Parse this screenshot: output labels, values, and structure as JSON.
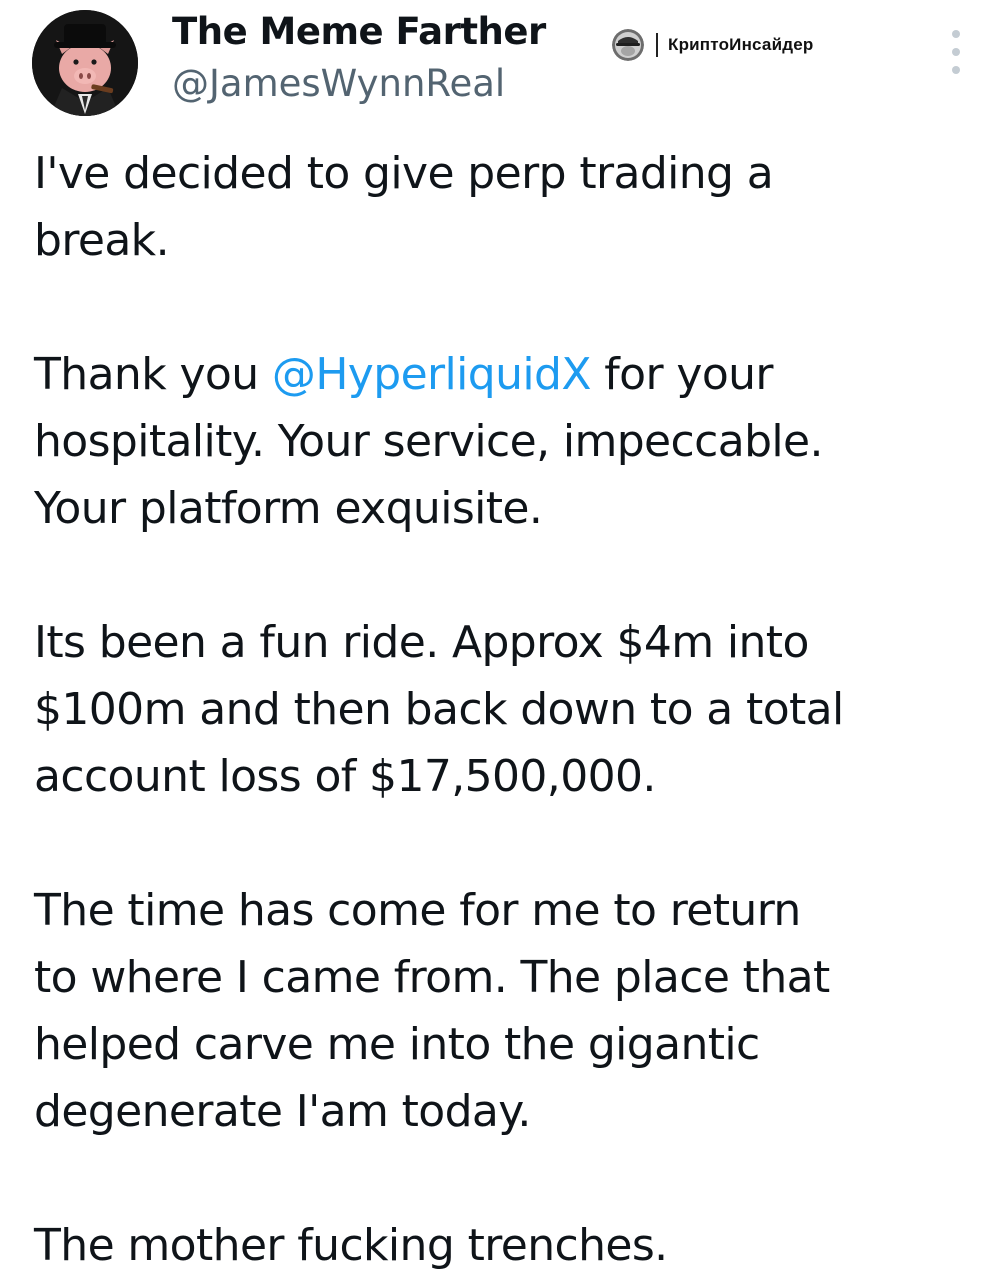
{
  "author": {
    "display_name": "The Meme Farther",
    "handle": "@JamesWynnReal",
    "avatar_icon": "pig-in-suit-avatar"
  },
  "watermark": {
    "logo_icon": "channel-logo-icon",
    "text": "КриптоИнсайдер"
  },
  "menu": {
    "icon": "vertical-ellipsis-icon"
  },
  "tweet": {
    "paragraph_1": "I've decided to give perp trading a\nbreak.",
    "paragraph_2_before": "Thank you ",
    "paragraph_2_mention": "@HyperliquidX",
    "paragraph_2_after": " for your\nhospitality. Your service, impeccable.\nYour platform exquisite.",
    "paragraph_3": "Its been a fun ride. Approx $4m into\n$100m and then back down to a total\naccount loss of $17,500,000.",
    "paragraph_4": "The time has come for me to return\nto where I came from. The place that\nhelped carve me into the gigantic\ndegenerate I'am today.",
    "paragraph_5": "The mother fucking trenches."
  },
  "colors": {
    "text": "#0f1419",
    "secondary": "#536471",
    "link": "#1d9bf0",
    "menu_dots": "#c4ccd3"
  }
}
